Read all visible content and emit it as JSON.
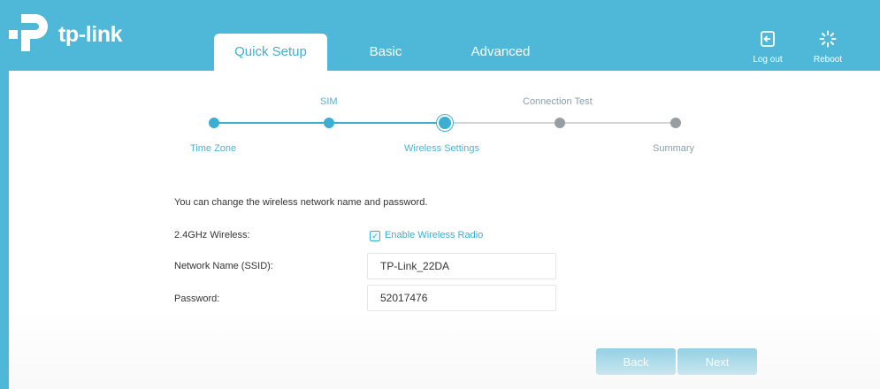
{
  "brand": {
    "name": "tp-link"
  },
  "nav": {
    "tabs": [
      {
        "label": "Quick Setup",
        "active": true
      },
      {
        "label": "Basic",
        "active": false
      },
      {
        "label": "Advanced",
        "active": false
      }
    ]
  },
  "toolbar": {
    "logout_label": "Log out",
    "logout_icon": "logout-icon",
    "reboot_label": "Reboot",
    "reboot_icon": "reboot-icon"
  },
  "wizard": {
    "steps": [
      {
        "label": "Time Zone",
        "state": "done"
      },
      {
        "label": "SIM",
        "state": "done"
      },
      {
        "label": "Wireless Settings",
        "state": "current"
      },
      {
        "label": "Connection Test",
        "state": "pending"
      },
      {
        "label": "Summary",
        "state": "pending"
      }
    ]
  },
  "form": {
    "intro": "You can change the wireless network name and password.",
    "band_label": "2.4GHz Wireless:",
    "enable_radio_label": "Enable Wireless Radio",
    "enable_radio_checked": true,
    "ssid_label": "Network Name (SSID):",
    "ssid_value": "TP-Link_22DA",
    "password_label": "Password:",
    "password_value": "52017476"
  },
  "actions": {
    "back_label": "Back",
    "next_label": "Next"
  },
  "colors": {
    "brand": "#4fb8d8",
    "accent": "#3aaed3",
    "pending": "#979ea3"
  }
}
